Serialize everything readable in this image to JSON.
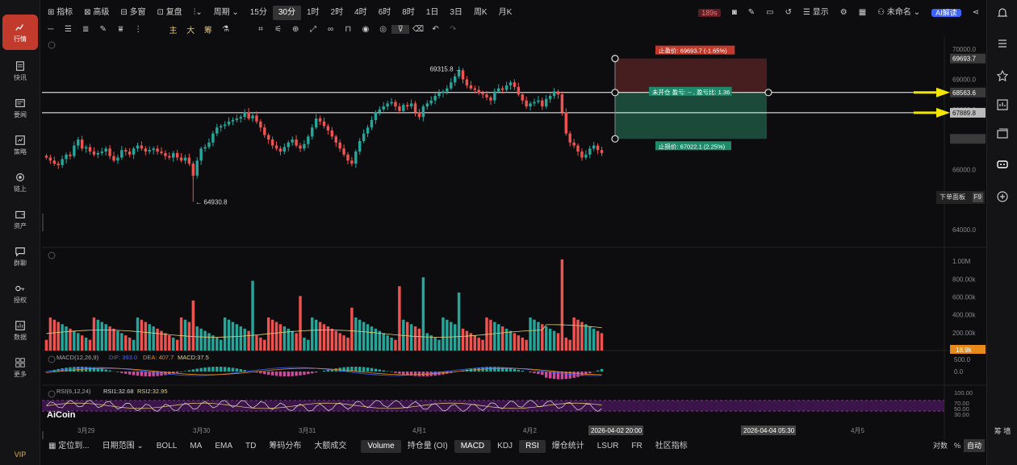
{
  "sidebar": {
    "items": [
      {
        "label": "行情",
        "icon": "chart-icon",
        "active": true
      },
      {
        "label": "快讯",
        "icon": "news-icon"
      },
      {
        "label": "要闻",
        "icon": "article-icon"
      },
      {
        "label": "策略",
        "icon": "strategy-icon"
      },
      {
        "label": "链上",
        "icon": "chain-icon"
      },
      {
        "label": "资产",
        "icon": "wallet-icon"
      },
      {
        "label": "群聊",
        "icon": "chat-icon"
      },
      {
        "label": "授权",
        "icon": "key-icon"
      },
      {
        "label": "数据",
        "icon": "data-icon"
      },
      {
        "label": "更多",
        "icon": "grid-icon"
      }
    ],
    "vip": "VIP"
  },
  "toolbar": {
    "indicator": "指标",
    "advanced": "高级",
    "multiwin": "多窗",
    "replay": "复盘",
    "period": "周期",
    "intervals": [
      "15分",
      "30分",
      "1时",
      "2时",
      "4时",
      "6时",
      "8时",
      "1日",
      "3日",
      "周K",
      "月K"
    ],
    "selected_interval": "30分",
    "badge": "189s",
    "display": "显示",
    "unnamed": "未命名",
    "ai": "AI解读"
  },
  "drawbar": {
    "zhu": "主",
    "da": "大",
    "chou": "筹"
  },
  "price_axis": {
    "ticks": [
      "70000.0",
      "69000.0",
      "68000.0",
      "67000.0",
      "66000.0",
      "65000.0",
      "64000.0"
    ],
    "labels": {
      "take_profit": "69693.7",
      "entry": "68563.6",
      "current": "67889.8",
      "stop": "67022.1"
    }
  },
  "volume_axis": {
    "ticks": [
      "1.00M",
      "800.00k",
      "600.00k",
      "400.00k",
      "200.00k"
    ],
    "current": "18.9k"
  },
  "macd_axis": {
    "ticks": [
      "500.0",
      "0.0"
    ]
  },
  "rsi_axis": {
    "ticks": [
      "100.00",
      "70.00",
      "50.00",
      "30.00"
    ]
  },
  "annotations": {
    "high": "69315.8",
    "low": "64930.8",
    "tp_label": "止盈价: 69693.7 (-1.65%)",
    "pos_label": "未开仓 盈亏: -- , 盈亏比: 1.36",
    "sl_label": "止损价: 67022.1 (2.25%)"
  },
  "indicators": {
    "macd": "MACD(12,26,9)",
    "dif": "DIF: 393.0",
    "dea": "DEA: 407.7",
    "macd_val": "MACD:37.5",
    "rsi": "RSI(6,12,24)",
    "rsi1": "RSI1:32.68",
    "rsi2": "RSI2:32.95"
  },
  "xaxis": {
    "dates": [
      "3月29",
      "3月30",
      "3月31",
      "4月1",
      "4月2",
      "4月3",
      "4月5"
    ],
    "cursor1": "2026-04-02 20:00",
    "cursor2": "2026-04-04 05:30"
  },
  "logo": "AiCoin",
  "tooltip": {
    "label": "下单面板",
    "key": "F9"
  },
  "bottombar": {
    "locate": "定位到...",
    "range": "日期范围",
    "items": [
      "BOLL",
      "MA",
      "EMA",
      "TD",
      "筹码分布",
      "大额成交"
    ],
    "items2": [
      "Volume",
      "持仓量 (OI)",
      "MACD",
      "KDJ",
      "RSI",
      "爆仓统计",
      "LSUR",
      "FR",
      "社区指标"
    ],
    "selected": [
      "Volume",
      "MACD",
      "RSI"
    ],
    "right": [
      "对数",
      "%",
      "自动"
    ]
  },
  "right_rail": {
    "top_labels": [
      "筹",
      "墙"
    ]
  },
  "colors": {
    "up": "#26a69a",
    "down": "#ef5350",
    "accent": "#3d63ff",
    "arrow": "#f5e600",
    "profit_zone": "#1f5a45",
    "loss_zone": "#5a2426",
    "rsi_band": "#3b1549"
  },
  "chart_data": {
    "type": "candlestick",
    "ylim": [
      63600,
      70300
    ],
    "high": 69315.8,
    "low": 64930.8,
    "entry": 68563.6,
    "current": 67889.8,
    "take_profit": 69693.7,
    "stop_loss": 67022.1,
    "closes": [
      66400,
      66300,
      66200,
      66150,
      66350,
      66500,
      66450,
      66800,
      67000,
      66700,
      66750,
      66600,
      66500,
      66550,
      66600,
      66700,
      66450,
      66300,
      66400,
      66650,
      66600,
      66500,
      66700,
      66800,
      66700,
      66600,
      66650,
      66700,
      66600,
      66550,
      66450,
      66400,
      66550,
      66400,
      66300,
      66400,
      66200,
      65800,
      66300,
      66700,
      66750,
      66900,
      67200,
      67400,
      67450,
      67500,
      67600,
      67650,
      67700,
      67750,
      67900,
      67700,
      67800,
      67600,
      67400,
      67150,
      67000,
      66800,
      66700,
      66600,
      66750,
      66900,
      67000,
      66800,
      66700,
      66850,
      67100,
      67400,
      67700,
      67600,
      67450,
      67300,
      67100,
      66900,
      66700,
      66500,
      66300,
      66200,
      66600,
      66950,
      67200,
      67400,
      67650,
      67900,
      68000,
      68100,
      68200,
      68250,
      68100,
      67950,
      68150,
      68100,
      68200,
      67900,
      67750,
      68100,
      68200,
      68300,
      68450,
      68550,
      68600,
      68700,
      68900,
      69100,
      69300,
      69000,
      68800,
      68700,
      68650,
      68550,
      68500,
      68400,
      68300,
      68600,
      68700,
      68650,
      68800,
      68900,
      68750,
      68500,
      68300,
      68100,
      68200,
      68250,
      68300,
      68100,
      68350,
      68450,
      68600,
      68500,
      67900,
      67200,
      66900,
      66800,
      66600,
      66400,
      66500,
      66700,
      66800,
      66650,
      66550
    ]
  }
}
